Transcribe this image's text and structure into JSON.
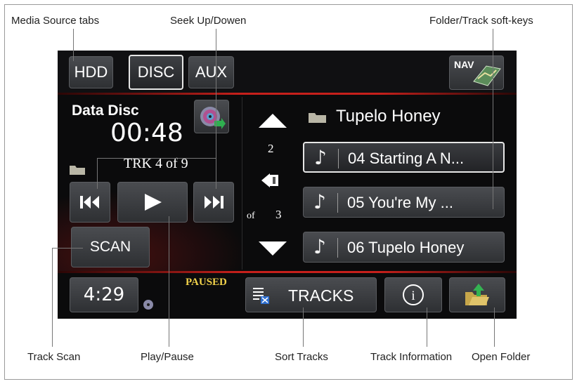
{
  "callouts": {
    "media_source_tabs": "Media Source tabs",
    "seek_up_down": "Seek Up/Dowen",
    "folder_track_softkeys": "Folder/Track soft-keys",
    "track_scan": "Track Scan",
    "play_pause": "Play/Pause",
    "sort_tracks": "Sort Tracks",
    "track_information": "Track Information",
    "open_folder": "Open Folder"
  },
  "tabs": [
    {
      "label": "HDD",
      "active": false
    },
    {
      "label": "DISC",
      "active": true
    },
    {
      "label": "AUX",
      "active": false
    }
  ],
  "nav_label": "NAV",
  "player": {
    "source_label": "Data Disc",
    "elapsed": "00:48",
    "track_info": "TRK 4 of 9",
    "scan_label": "SCAN",
    "clock": "4:29",
    "status": "PAUSED"
  },
  "pager": {
    "current": "2",
    "of_label": "of",
    "total": "3"
  },
  "folder_name": "Tupelo Honey",
  "tracks": [
    {
      "name": "04 Starting A N...",
      "selected": true
    },
    {
      "name": "05 You're My ...",
      "selected": false
    },
    {
      "name": "06 Tupelo Honey",
      "selected": false
    }
  ],
  "bottom": {
    "tracks_label": "TRACKS",
    "info_symbol": "i"
  },
  "icons": {
    "seek_back": "skip-back-icon",
    "play": "play-icon",
    "seek_fwd": "skip-forward-icon",
    "up": "up-arrow-icon",
    "down": "down-arrow-icon",
    "back_folder": "folder-back-icon",
    "note": "music-note-icon",
    "folder": "folder-icon",
    "disc": "disc-source-icon",
    "nav": "map-icon",
    "sort": "sort-list-icon",
    "info": "info-icon",
    "open_folder": "open-folder-icon"
  },
  "colors": {
    "accent_red": "#c6201b",
    "status_yellow": "#f2d24a",
    "screen_bg": "#0b0b0c"
  }
}
